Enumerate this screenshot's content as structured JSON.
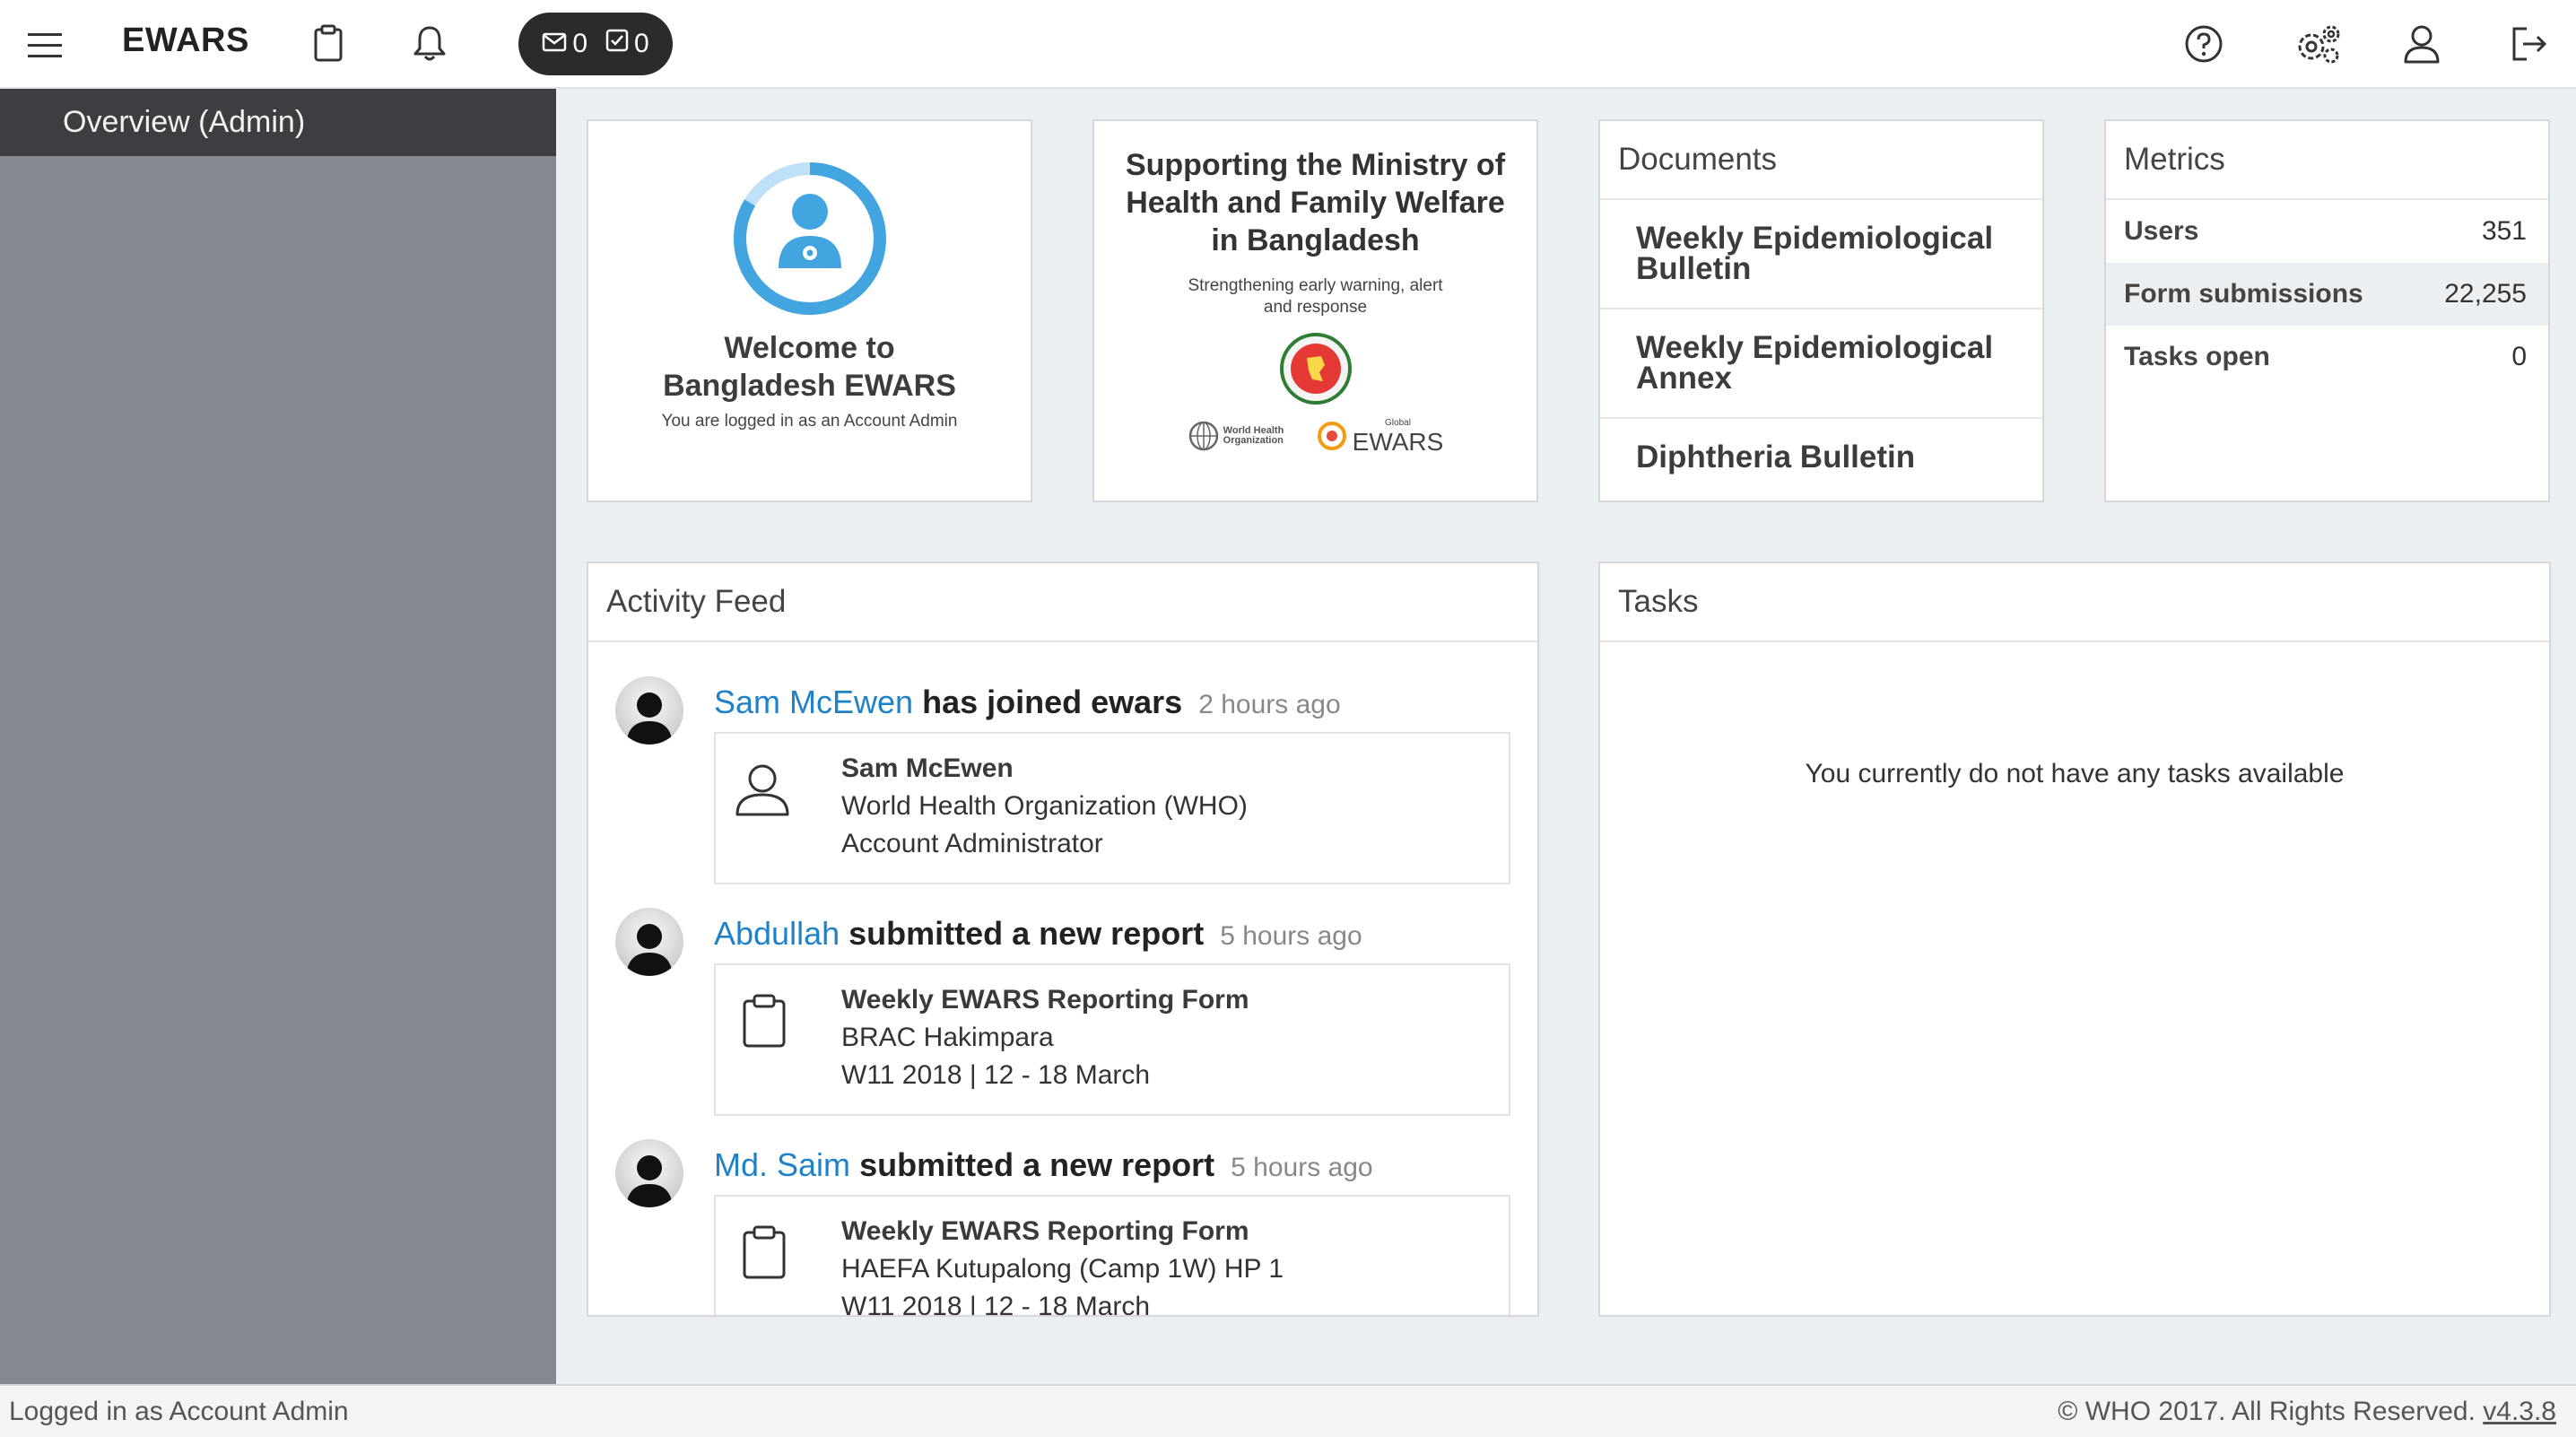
{
  "header": {
    "brand": "EWARS",
    "inbox_count": "0",
    "tasks_count": "0",
    "icons": [
      "menu-icon",
      "clipboard-icon",
      "bell-icon",
      "envelope-icon",
      "check-square-icon",
      "help-icon",
      "gears-icon",
      "user-icon",
      "logout-icon"
    ]
  },
  "sidebar": {
    "items": [
      {
        "label": "Overview (Admin)"
      }
    ]
  },
  "welcome": {
    "title": "Welcome to Bangladesh EWARS",
    "subtitle": "You are logged in as an Account Admin"
  },
  "support": {
    "title": "Supporting the Ministry of Health and Family Welfare in Bangladesh",
    "subtitle": "Strengthening early warning, alert and response",
    "who_logo_text": "World Health Organization",
    "ewars_logo_small": "Global",
    "ewars_logo_text": "EWARS"
  },
  "documents": {
    "title": "Documents",
    "items": [
      {
        "label": "Weekly Epidemiological Bulletin"
      },
      {
        "label": "Weekly Epidemiological Annex"
      },
      {
        "label": "Diphtheria Bulletin"
      }
    ]
  },
  "metrics": {
    "title": "Metrics",
    "rows": [
      {
        "label": "Users",
        "value": "351"
      },
      {
        "label": "Form submissions",
        "value": "22,255"
      },
      {
        "label": "Tasks open",
        "value": "0"
      }
    ]
  },
  "activity": {
    "title": "Activity Feed",
    "items": [
      {
        "user": "Sam McEwen",
        "action": "has joined ewars",
        "time": "2 hours ago",
        "icon": "user-icon",
        "lines": [
          "Sam McEwen",
          "World Health Organization (WHO)",
          "Account Administrator"
        ]
      },
      {
        "user": "Abdullah",
        "action": "submitted a new report",
        "time": "5 hours ago",
        "icon": "clipboard-icon",
        "lines": [
          "Weekly EWARS Reporting Form",
          "BRAC Hakimpara",
          "W11 2018 | 12 - 18 March"
        ]
      },
      {
        "user": "Md. Saim",
        "action": "submitted a new report",
        "time": "5 hours ago",
        "icon": "clipboard-icon",
        "lines": [
          "Weekly EWARS Reporting Form",
          "HAEFA Kutupalong (Camp 1W) HP 1",
          "W11 2018 | 12 - 18 March"
        ]
      }
    ]
  },
  "tasks": {
    "title": "Tasks",
    "empty_message": "You currently do not have any tasks available"
  },
  "footer": {
    "left": "Logged in as Account Admin",
    "right": "© WHO 2017. All Rights Reserved.",
    "version": "v4.3.8"
  },
  "colors": {
    "link_blue": "#1f82c8",
    "sidebar_bg": "#858890",
    "sidebar_active": "#3d3e41",
    "pill_bg": "#2b2b2b",
    "welcome_ring": "#42a5e0"
  }
}
